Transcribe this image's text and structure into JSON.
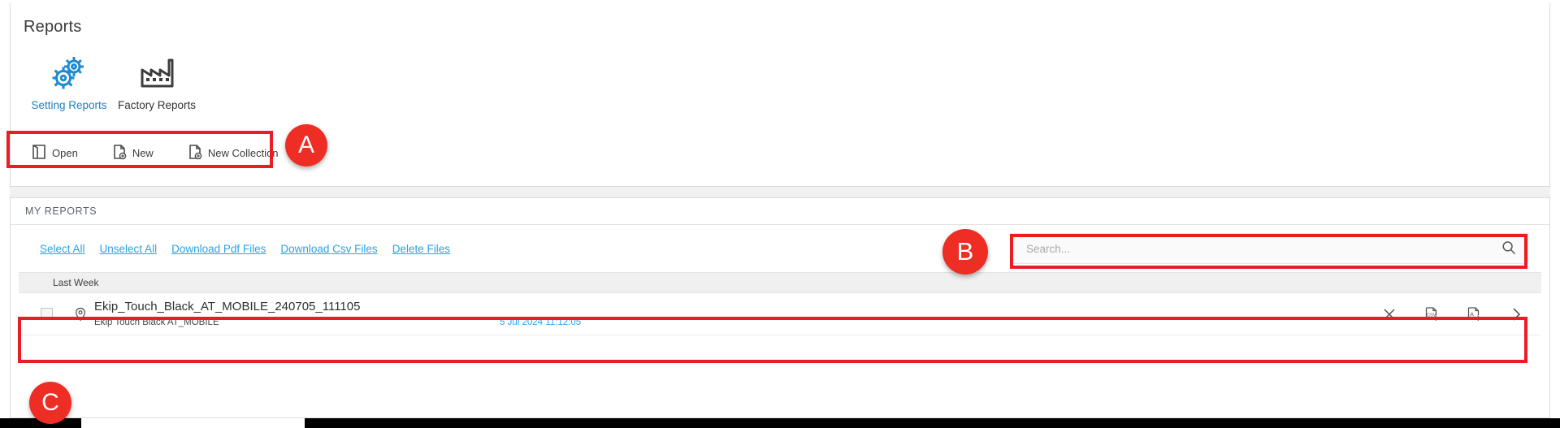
{
  "header": {
    "title": "Reports"
  },
  "ribbon": {
    "items": [
      {
        "label": "Setting Reports",
        "icon": "gears-icon",
        "active": true
      },
      {
        "label": "Factory Reports",
        "icon": "factory-icon",
        "active": false
      }
    ]
  },
  "toolbar": {
    "open_label": "Open",
    "new_label": "New",
    "new_collection_label": "New Collection"
  },
  "reports": {
    "panel_title": "MY REPORTS",
    "links": [
      {
        "label": "Select All"
      },
      {
        "label": "Unselect All"
      },
      {
        "label": "Download Pdf Files"
      },
      {
        "label": "Download Csv Files"
      },
      {
        "label": "Delete Files"
      }
    ],
    "search": {
      "placeholder": "Search...",
      "value": ""
    },
    "group_label": "Last Week",
    "rows": [
      {
        "title": "Ekip_Touch_Black_AT_MOBILE_240705_111105",
        "subtitle": "Ekip Touch Black AT_MOBILE",
        "date": "5 Jul 2024 11:12:05"
      }
    ]
  },
  "callouts": [
    {
      "letter": "A"
    },
    {
      "letter": "B"
    },
    {
      "letter": "C"
    }
  ],
  "colors": {
    "accent_red": "#ed1c24",
    "link_blue": "#29a3e8",
    "ribbon_blue": "#1f7fc4"
  }
}
